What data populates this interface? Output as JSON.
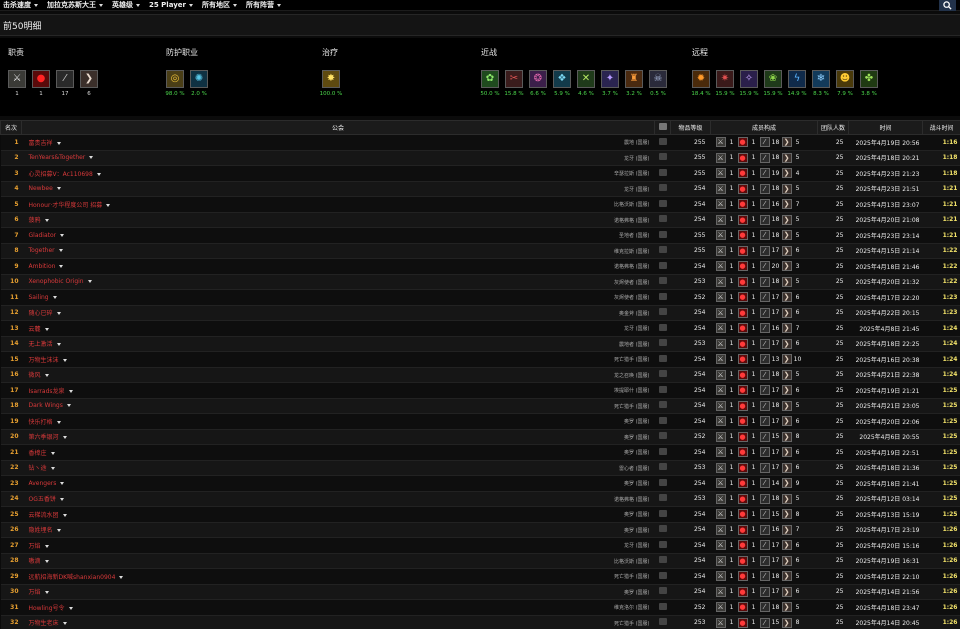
{
  "nav": {
    "items": [
      "击杀速度",
      "加拉克苏斯大王",
      "英雄级",
      "25 Player",
      "所有地区",
      "所有阵营"
    ]
  },
  "page": {
    "title": "前50明细"
  },
  "summary": {
    "groups": [
      {
        "title": "职责",
        "icons": [
          {
            "name": "tank-role-icon",
            "glyph": "⚔",
            "bg": "#3a3a36",
            "color": "#ddd",
            "value": "1",
            "cls": "w"
          },
          {
            "name": "healer-role-icon",
            "glyph": "●",
            "bg": "#5a0a0a",
            "color": "#ff2424",
            "value": "1",
            "cls": "w"
          },
          {
            "name": "melee-role-icon",
            "glyph": "⁄",
            "bg": "#2a2a2a",
            "color": "#ccc",
            "value": "17",
            "cls": "w"
          },
          {
            "name": "ranged-role-icon",
            "glyph": "❯",
            "bg": "#3b2f2a",
            "color": "#eadbcf",
            "value": "6",
            "cls": "w"
          }
        ]
      },
      {
        "title": "防护职业",
        "icons": [
          {
            "name": "paladin-protection-icon",
            "glyph": "◎",
            "bg": "#4a3e16",
            "color": "#f1c43a",
            "value": "98.0 %",
            "cls": "g"
          },
          {
            "name": "warrior-protection-icon",
            "glyph": "✺",
            "bg": "#0f3142",
            "color": "#59c8e8",
            "value": "2.0 %",
            "cls": "g"
          }
        ]
      },
      {
        "title": "治疗",
        "icons": [
          {
            "name": "holy-light-icon",
            "glyph": "✸",
            "bg": "#5e4a10",
            "color": "#ffe266",
            "value": "100.0 %",
            "cls": "g"
          }
        ]
      },
      {
        "title": "近战",
        "icons": [
          {
            "name": "feral-spirit-icon",
            "glyph": "✿",
            "bg": "#1f4a1e",
            "color": "#8ee86a",
            "value": "50.0 %",
            "cls": "g"
          },
          {
            "name": "rogue-blade-icon",
            "glyph": "✂",
            "bg": "#3a1c1c",
            "color": "#d55",
            "value": "15.8 %",
            "cls": "g"
          },
          {
            "name": "warlock-shadow-icon",
            "glyph": "❂",
            "bg": "#3b1f4a",
            "color": "#d6a",
            "value": "6.6 %",
            "cls": "g"
          },
          {
            "name": "frost-strike-icon",
            "glyph": "❖",
            "bg": "#123a4a",
            "color": "#7cd9f5",
            "value": "5.9 %",
            "cls": "g"
          },
          {
            "name": "poison-blade-icon",
            "glyph": "✕",
            "bg": "#1f3a1a",
            "color": "#b7e864",
            "value": "4.6 %",
            "cls": "g"
          },
          {
            "name": "storm-strike-icon",
            "glyph": "✦",
            "bg": "#2a2450",
            "color": "#b59aff",
            "value": "3.7 %",
            "cls": "g"
          },
          {
            "name": "crusader-strike-icon",
            "glyph": "♜",
            "bg": "#4a2a10",
            "color": "#f79a3a",
            "value": "3.2 %",
            "cls": "g"
          },
          {
            "name": "death-knight-icon",
            "glyph": "☠",
            "bg": "#2a2a3a",
            "color": "#a9b7d9",
            "value": "0.5 %",
            "cls": "g"
          }
        ]
      },
      {
        "title": "远程",
        "icons": [
          {
            "name": "fire-mage-icon",
            "glyph": "✹",
            "bg": "#4a2a0a",
            "color": "#ff9a2a",
            "value": "18.4 %",
            "cls": "g"
          },
          {
            "name": "beast-mastery-icon",
            "glyph": "✷",
            "bg": "#3a1a1a",
            "color": "#e05050",
            "value": "15.9 %",
            "cls": "g"
          },
          {
            "name": "arcane-mage-icon",
            "glyph": "✧",
            "bg": "#2a1f4a",
            "color": "#c8a8ff",
            "value": "15.9 %",
            "cls": "g"
          },
          {
            "name": "affliction-icon",
            "glyph": "❀",
            "bg": "#1f3a1a",
            "color": "#8ed64a",
            "value": "15.9 %",
            "cls": "g"
          },
          {
            "name": "elemental-lightning-icon",
            "glyph": "ϟ",
            "bg": "#0f2a4a",
            "color": "#5ab4ff",
            "value": "14.9 %",
            "cls": "g"
          },
          {
            "name": "frost-mage-icon",
            "glyph": "❄",
            "bg": "#123a5a",
            "color": "#8fd0ff",
            "value": "8.3 %",
            "cls": "g"
          },
          {
            "name": "shadow-priest-icon",
            "glyph": "☻",
            "bg": "#4a3a0a",
            "color": "#ffcc33",
            "value": "7.9 %",
            "cls": "g"
          },
          {
            "name": "balance-druid-icon",
            "glyph": "✤",
            "bg": "#1f3a12",
            "color": "#9ee05a",
            "value": "3.8 %",
            "cls": "g"
          }
        ]
      }
    ]
  },
  "table": {
    "headers": {
      "rank": "名次",
      "guild": "公会",
      "items": "物品等级",
      "comp": "成员构成",
      "size": "团队人数",
      "time": "时间",
      "dur": "战斗时间"
    },
    "rows": [
      {
        "rank": "1",
        "guild": "富贵吉祥",
        "realm": "震地 (国服)",
        "ilvl": "255",
        "c": [
          "1",
          "1",
          "18",
          "5"
        ],
        "size": "25",
        "time": "2025年4月19日 20:56",
        "dur": "1:16"
      },
      {
        "rank": "2",
        "guild": "TenYears&Together",
        "realm": "龙牙 (国服)",
        "ilvl": "255",
        "c": [
          "1",
          "1",
          "18",
          "5"
        ],
        "size": "25",
        "time": "2025年4月18日 20:21",
        "dur": "1:18"
      },
      {
        "rank": "3",
        "guild": "心灵招募V：Ac110698",
        "realm": "辛瑟拉斯 (国服)",
        "ilvl": "255",
        "c": [
          "1",
          "1",
          "19",
          "4"
        ],
        "size": "25",
        "time": "2025年4月23日 21:23",
        "dur": "1:18"
      },
      {
        "rank": "4",
        "guild": "Newbee",
        "realm": "龙牙 (国服)",
        "ilvl": "254",
        "c": [
          "1",
          "1",
          "18",
          "5"
        ],
        "size": "25",
        "time": "2025年4月23日 21:51",
        "dur": "1:21"
      },
      {
        "rank": "5",
        "guild": "Honour·才华程度公司 招募",
        "realm": "比格沃斯 (国服)",
        "ilvl": "254",
        "c": [
          "1",
          "1",
          "16",
          "7"
        ],
        "size": "25",
        "time": "2025年4月13日 23:07",
        "dur": "1:21"
      },
      {
        "rank": "6",
        "guild": "菠鸦",
        "realm": "诺格弗格 (国服)",
        "ilvl": "254",
        "c": [
          "1",
          "1",
          "18",
          "5"
        ],
        "size": "25",
        "time": "2025年4月20日 21:08",
        "dur": "1:21"
      },
      {
        "rank": "7",
        "guild": "Gladiator",
        "realm": "圣地者 (国服)",
        "ilvl": "255",
        "c": [
          "1",
          "1",
          "18",
          "5"
        ],
        "size": "25",
        "time": "2025年4月23日 23:14",
        "dur": "1:21"
      },
      {
        "rank": "8",
        "guild": "Together",
        "realm": "维克拉斯 (国服)",
        "ilvl": "255",
        "c": [
          "1",
          "1",
          "17",
          "6"
        ],
        "size": "25",
        "time": "2025年4月15日 21:14",
        "dur": "1:22"
      },
      {
        "rank": "9",
        "guild": "Ambition",
        "realm": "诺格弗格 (国服)",
        "ilvl": "254",
        "c": [
          "1",
          "1",
          "20",
          "3"
        ],
        "size": "25",
        "time": "2025年4月18日 21:46",
        "dur": "1:22"
      },
      {
        "rank": "10",
        "guild": "Xenophobic Origin",
        "realm": "灰烬使者 (国服)",
        "ilvl": "253",
        "c": [
          "1",
          "1",
          "18",
          "5"
        ],
        "size": "25",
        "time": "2025年4月20日 21:32",
        "dur": "1:22"
      },
      {
        "rank": "11",
        "guild": "Sailing",
        "realm": "灰烬使者 (国服)",
        "ilvl": "252",
        "c": [
          "1",
          "1",
          "17",
          "6"
        ],
        "size": "25",
        "time": "2025年4月17日 22:20",
        "dur": "1:23"
      },
      {
        "rank": "12",
        "guild": "随心已碎",
        "realm": "奥金斧 (国服)",
        "ilvl": "254",
        "c": [
          "1",
          "1",
          "17",
          "6"
        ],
        "size": "25",
        "time": "2025年4月22日 20:15",
        "dur": "1:23"
      },
      {
        "rank": "13",
        "guild": "云麓",
        "realm": "龙牙 (国服)",
        "ilvl": "254",
        "c": [
          "1",
          "1",
          "16",
          "7"
        ],
        "size": "25",
        "time": "2025年4月8日 21:45",
        "dur": "1:24"
      },
      {
        "rank": "14",
        "guild": "无上激活",
        "realm": "震地者 (国服)",
        "ilvl": "253",
        "c": [
          "1",
          "1",
          "17",
          "6"
        ],
        "size": "25",
        "time": "2025年4月18日 22:25",
        "dur": "1:24"
      },
      {
        "rank": "15",
        "guild": "万物生沫沫",
        "realm": "死亡猎手 (国服)",
        "ilvl": "254",
        "c": [
          "1",
          "1",
          "13",
          "10"
        ],
        "size": "25",
        "time": "2025年4月16日 20:38",
        "dur": "1:24"
      },
      {
        "rank": "16",
        "guild": "微风",
        "realm": "龙之召唤 (国服)",
        "ilvl": "254",
        "c": [
          "1",
          "1",
          "18",
          "5"
        ],
        "size": "25",
        "time": "2025年4月21日 22:38",
        "dur": "1:24"
      },
      {
        "rank": "17",
        "guild": "Isarrads龙泉",
        "realm": "埃提耶什 (国服)",
        "ilvl": "254",
        "c": [
          "1",
          "1",
          "17",
          "6"
        ],
        "size": "25",
        "time": "2025年4月19日 21:21",
        "dur": "1:25"
      },
      {
        "rank": "18",
        "guild": "Dark Wings",
        "realm": "死亡猎手 (国服)",
        "ilvl": "254",
        "c": [
          "1",
          "1",
          "18",
          "5"
        ],
        "size": "25",
        "time": "2025年4月21日 23:05",
        "dur": "1:25"
      },
      {
        "rank": "19",
        "guild": "快乐打格",
        "realm": "奥罗 (国服)",
        "ilvl": "254",
        "c": [
          "1",
          "1",
          "17",
          "6"
        ],
        "size": "25",
        "time": "2025年4月20日 22:06",
        "dur": "1:25"
      },
      {
        "rank": "20",
        "guild": "第六季银河",
        "realm": "奥罗 (国服)",
        "ilvl": "252",
        "c": [
          "1",
          "1",
          "15",
          "8"
        ],
        "size": "25",
        "time": "2025年4月6日 20:55",
        "dur": "1:25"
      },
      {
        "rank": "21",
        "guild": "香樟庄",
        "realm": "奥罗 (国服)",
        "ilvl": "254",
        "c": [
          "1",
          "1",
          "17",
          "6"
        ],
        "size": "25",
        "time": "2025年4月19日 22:51",
        "dur": "1:25"
      },
      {
        "rank": "22",
        "guild": "钻ヽ途",
        "realm": "雷心者 (国服)",
        "ilvl": "253",
        "c": [
          "1",
          "1",
          "17",
          "6"
        ],
        "size": "25",
        "time": "2025年4月18日 21:36",
        "dur": "1:25"
      },
      {
        "rank": "23",
        "guild": "Avengers",
        "realm": "奥罗 (国服)",
        "ilvl": "254",
        "c": [
          "1",
          "1",
          "14",
          "9"
        ],
        "size": "25",
        "time": "2025年4月18日 21:41",
        "dur": "1:25"
      },
      {
        "rank": "24",
        "guild": "OG五香饼",
        "realm": "诺格弗格 (国服)",
        "ilvl": "253",
        "c": [
          "1",
          "1",
          "18",
          "5"
        ],
        "size": "25",
        "time": "2025年4月12日 03:14",
        "dur": "1:25"
      },
      {
        "rank": "25",
        "guild": "云梯流水团",
        "realm": "奥罗 (国服)",
        "ilvl": "254",
        "c": [
          "1",
          "1",
          "15",
          "8"
        ],
        "size": "25",
        "time": "2025年4月13日 15:19",
        "dur": "1:25"
      },
      {
        "rank": "26",
        "guild": "隐姓埋名",
        "realm": "奥罗 (国服)",
        "ilvl": "254",
        "c": [
          "1",
          "1",
          "16",
          "7"
        ],
        "size": "25",
        "time": "2025年4月17日 23:19",
        "dur": "1:26"
      },
      {
        "rank": "27",
        "guild": "万焰",
        "realm": "龙牙 (国服)",
        "ilvl": "254",
        "c": [
          "1",
          "1",
          "17",
          "6"
        ],
        "size": "25",
        "time": "2025年4月20日 15:16",
        "dur": "1:26"
      },
      {
        "rank": "28",
        "guild": "嗷滴",
        "realm": "比格沃斯 (国服)",
        "ilvl": "254",
        "c": [
          "1",
          "1",
          "17",
          "6"
        ],
        "size": "25",
        "time": "2025年4月19日 16:31",
        "dur": "1:26"
      },
      {
        "rank": "29",
        "guild": "远航招海新DK喊shanxian0904",
        "realm": "死亡猎手 (国服)",
        "ilvl": "254",
        "c": [
          "1",
          "1",
          "18",
          "5"
        ],
        "size": "25",
        "time": "2025年4月12日 22:10",
        "dur": "1:26"
      },
      {
        "rank": "30",
        "guild": "万焰",
        "realm": "奥罗 (国服)",
        "ilvl": "254",
        "c": [
          "1",
          "1",
          "17",
          "6"
        ],
        "size": "25",
        "time": "2025年4月14日 21:56",
        "dur": "1:26"
      },
      {
        "rank": "31",
        "guild": "Howling号令",
        "realm": "维克洛尔 (国服)",
        "ilvl": "252",
        "c": [
          "1",
          "1",
          "18",
          "5"
        ],
        "size": "25",
        "time": "2025年4月18日 23:47",
        "dur": "1:26"
      },
      {
        "rank": "32",
        "guild": "万物生老床",
        "realm": "死亡猎手 (国服)",
        "ilvl": "253",
        "c": [
          "1",
          "1",
          "15",
          "8"
        ],
        "size": "25",
        "time": "2025年4月14日 20:45",
        "dur": "1:26"
      }
    ]
  }
}
